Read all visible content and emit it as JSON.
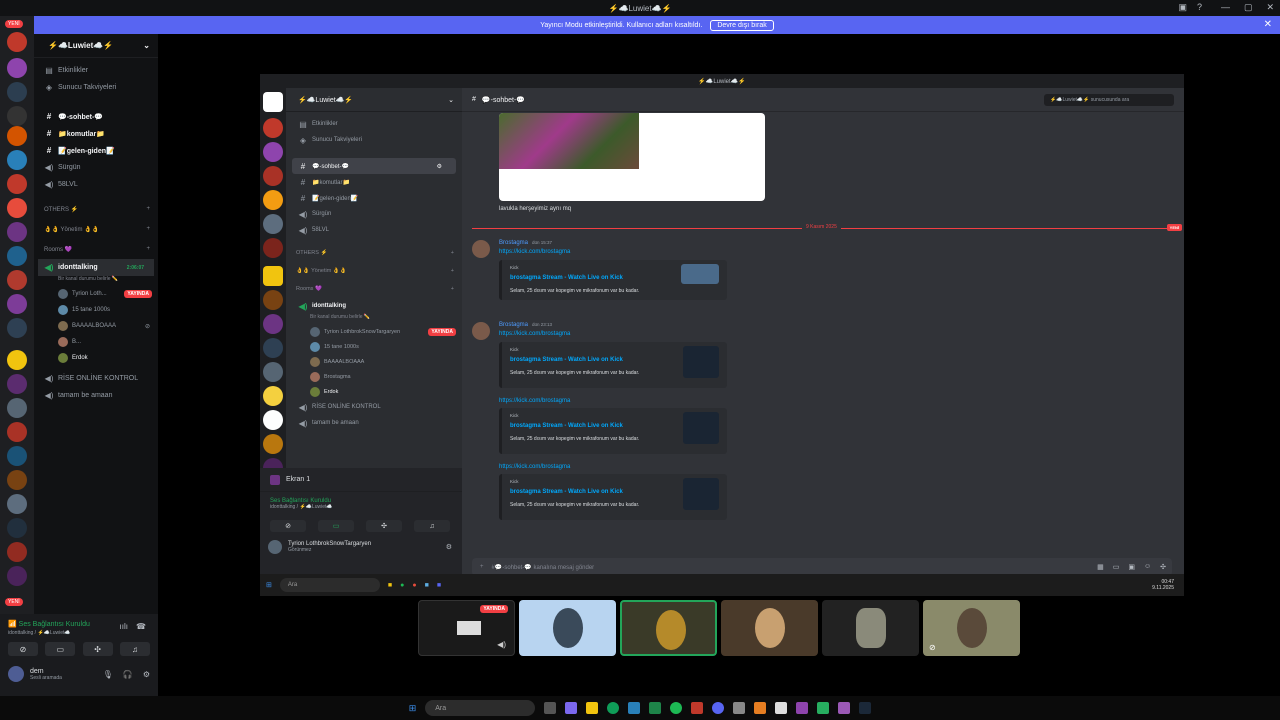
{
  "window": {
    "title": "⚡☁️Luwiet☁️⚡"
  },
  "banner": {
    "text": "Yayıncı Modu etkinleştirildi. Kullanıcı adları kısaltıldı.",
    "button": "Devre dışı bırak"
  },
  "sidebar": {
    "new_badge": "YENİ",
    "server_name": "⚡☁️Luwiet☁️⚡",
    "top_items": [
      "Etkinlikler",
      "Sunucu Takviyeleri"
    ],
    "channels": [
      {
        "icon": "#",
        "label": "💬-sohbet-💬"
      },
      {
        "icon": "#",
        "label": "📁komutlar📁"
      },
      {
        "icon": "#",
        "label": "📝gelen-giden📝"
      },
      {
        "icon": "voice",
        "label": "Sürgün"
      },
      {
        "icon": "voice",
        "label": "58LVL"
      }
    ],
    "cat_others": "OTHERS ⚡",
    "yonetim": "👌👌 Yönetim 👌👌",
    "cat_rooms": "Rooms 💜",
    "voice_channel": "idonttalking",
    "voice_time": "2:06:07",
    "voice_status": "Bir kanal durumu belirle ✏️",
    "members": [
      "Tyrion Loth...",
      "15 tane 1000s",
      "BAAAALBOAAA",
      "B...",
      "Erdok"
    ],
    "live_label": "YAYINDA",
    "other_voice": [
      "RİSE ONLİNE KONTROL",
      "tamam be amaan"
    ]
  },
  "panel": {
    "connection": "Ses Bağlantısı Kuruldu",
    "connection_sub": "idonttalking / ⚡☁️Luwiet☁️",
    "username": "dem",
    "user_status": "Sesli aramada"
  },
  "stream": {
    "title": "⚡☁️Luwiet☁️⚡",
    "server_name": "⚡☁️Luwiet☁️⚡",
    "top_items": [
      "Etkinlikler",
      "Sunucu Takviyeleri"
    ],
    "channels": [
      "💬-sohbet-💬",
      "📁komutlar📁",
      "📝gelen-giden📝",
      "Sürgün",
      "58LVL"
    ],
    "cat_others": "OTHERS ⚡",
    "yonetim": "👌👌 Yönetim 👌👌",
    "cat_rooms": "Rooms 💜",
    "voice_channel": "idonttalking",
    "voice_status": "Bir kanal durumu belirle ✏️",
    "members": [
      "Tyrion LothbrokSnowTargaryen",
      "15 tane 1000s",
      "BAAAALBOAAA",
      "Brostagma",
      "Erdok"
    ],
    "live_label": "YAYINDA",
    "other_voice": [
      "RİSE ONLİNE KONTROL",
      "tamam be amaan"
    ],
    "ekran": "Ekran 1",
    "connection": "Ses Bağlantısı Kuruldu",
    "connection_sub": "idonttalking / ⚡☁️Luwiet☁️",
    "user": "Tyrion LothbrokSnowTargaryen",
    "user_status": "Görünmez",
    "channel_header": "💬-sohbet-💬",
    "search_placeholder": "⚡☁️Luwiet☁️⚡ sunucusunda ara",
    "first_msg": "lavukla herşeyimiz aynı mq",
    "date_divider": "9 Kasım 2025",
    "new_label": "YENİ",
    "author": "Brostagma",
    "time1": "dün 15:37",
    "time2": "dün 23:13",
    "link": "https://kick.com/brostagma",
    "embed_provider": "Kick",
    "embed_title": "brostagma Stream - Watch Live on Kick",
    "embed_desc": "Selam, 25 dısım var kopegim ve mikrafonum var bu kadar.",
    "composer_placeholder": "#💬-sohbet-💬 kanalına mesaj gönder",
    "taskbar_search": "Ara",
    "clock_time": "00:47",
    "clock_date": "9.11.2025"
  },
  "tiles": {
    "live_label": "YAYINDA"
  },
  "taskbar": {
    "search": "Ara"
  }
}
